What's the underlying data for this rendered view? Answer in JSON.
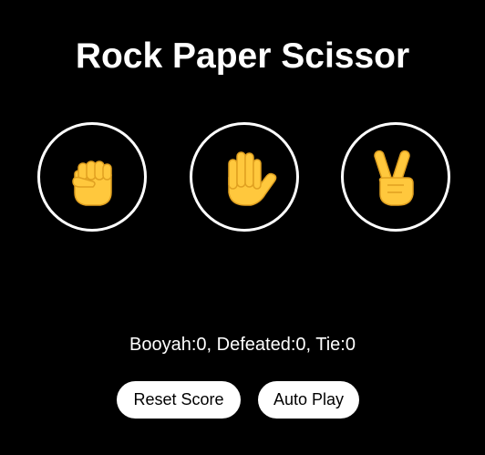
{
  "title": "Rock Paper Scissor",
  "choices": [
    {
      "id": "rock",
      "icon": "raised-fist-icon"
    },
    {
      "id": "paper",
      "icon": "raised-hand-icon"
    },
    {
      "id": "scissor",
      "icon": "victory-hand-icon"
    }
  ],
  "score": {
    "text": "Booyah:0, Defeated:0, Tie:0"
  },
  "buttons": {
    "reset_label": "Reset Score",
    "autoplay_label": "Auto Play"
  },
  "colors": {
    "background": "#000000",
    "foreground": "#ffffff",
    "emoji_skin": "#FFC83D",
    "emoji_shade": "#E0A020"
  }
}
